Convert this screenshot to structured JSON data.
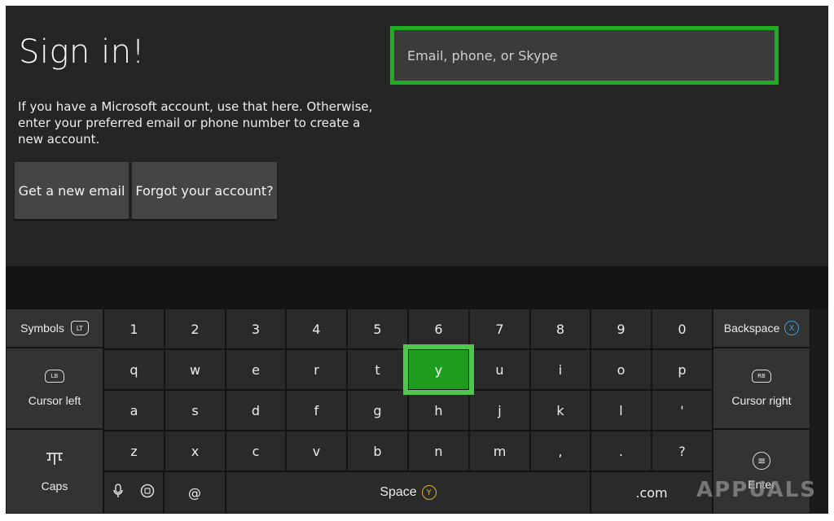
{
  "signin": {
    "title": "Sign in!",
    "description": "If you have a Microsoft account, use that here. Otherwise, enter your preferred email or phone number to create a new account.",
    "get_new_email": "Get a new email",
    "forgot_account": "Forgot your account?",
    "email_placeholder": "Email, phone, or Skype",
    "email_value": ""
  },
  "keyboard": {
    "symbols": "Symbols",
    "symbols_badge": "LT",
    "backspace": "Backspace",
    "backspace_badge": "X",
    "cursor_left": "Cursor left",
    "cursor_left_badge": "LB",
    "cursor_right": "Cursor right",
    "cursor_right_badge": "RB",
    "caps": "Caps",
    "enter": "Enter",
    "space": "Space",
    "space_badge": "Y",
    "at": "@",
    "dotcom": ".com",
    "focused_key": "y",
    "rows": [
      [
        "1",
        "2",
        "3",
        "4",
        "5",
        "6",
        "7",
        "8",
        "9",
        "0"
      ],
      [
        "q",
        "w",
        "e",
        "r",
        "t",
        "y",
        "u",
        "i",
        "o",
        "p"
      ],
      [
        "a",
        "s",
        "d",
        "f",
        "g",
        "h",
        "j",
        "k",
        "l",
        "'"
      ],
      [
        "z",
        "x",
        "c",
        "v",
        "b",
        "n",
        "m",
        ",",
        ".",
        "?"
      ]
    ]
  },
  "watermark": "APPUALS",
  "colors": {
    "accent": "#1fae22",
    "background": "#252525",
    "key": "#2a2a2a"
  }
}
